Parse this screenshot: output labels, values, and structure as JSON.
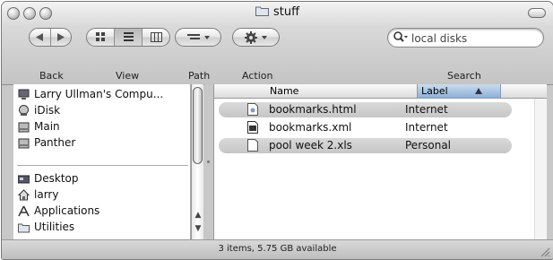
{
  "window": {
    "title": "stuff"
  },
  "toolbar": {
    "back_label": "Back",
    "view_label": "View",
    "path_label": "Path",
    "action_label": "Action",
    "search_label": "Search"
  },
  "search": {
    "placeholder": "local disks"
  },
  "sidebar": {
    "devices": [
      {
        "label": "Larry Ullman's Compu...",
        "icon": "computer-icon"
      },
      {
        "label": "iDisk",
        "icon": "idisk-icon"
      },
      {
        "label": "Main",
        "icon": "drive-icon"
      },
      {
        "label": "Panther",
        "icon": "drive-icon"
      }
    ],
    "places": [
      {
        "label": "Desktop",
        "icon": "desktop-icon"
      },
      {
        "label": "larry",
        "icon": "home-icon"
      },
      {
        "label": "Applications",
        "icon": "applications-icon"
      },
      {
        "label": "Utilities",
        "icon": "folder-icon"
      }
    ]
  },
  "list": {
    "columns": {
      "name": "Name",
      "label": "Label"
    },
    "rows": [
      {
        "name": "bookmarks.html",
        "label": "Internet",
        "icon": "html-file-icon"
      },
      {
        "name": "bookmarks.xml",
        "label": "Internet",
        "icon": "xml-file-icon"
      },
      {
        "name": "pool week 2.xls",
        "label": "Personal",
        "icon": "document-icon"
      }
    ]
  },
  "status": {
    "text": "3 items, 5.75 GB available"
  }
}
